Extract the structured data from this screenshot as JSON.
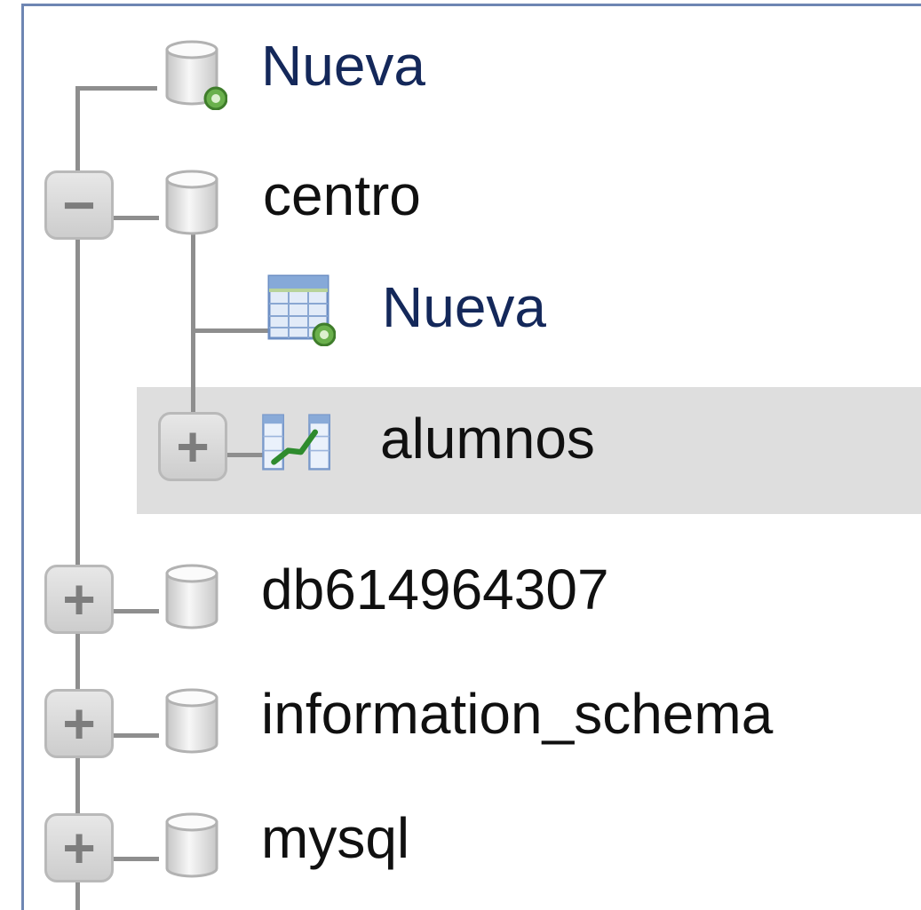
{
  "navigation_tree": {
    "new_database": {
      "label": "Nueva",
      "icon": "new-database-icon"
    },
    "databases": [
      {
        "name": "centro",
        "expanded": true,
        "expander_symbol": "−",
        "icon": "database-icon",
        "children": {
          "new_table": {
            "label": "Nueva",
            "icon": "new-table-icon"
          },
          "tables": [
            {
              "name": "alumnos",
              "expander_symbol": "+",
              "icon": "table-structure-icon",
              "highlighted": true
            }
          ]
        }
      },
      {
        "name": "db614964307",
        "expanded": false,
        "expander_symbol": "+",
        "icon": "database-icon"
      },
      {
        "name": "information_schema",
        "expanded": false,
        "expander_symbol": "+",
        "icon": "database-icon"
      },
      {
        "name": "mysql",
        "expanded": false,
        "expander_symbol": "+",
        "icon": "database-icon"
      }
    ]
  },
  "colors": {
    "frame_border": "#6e86b3",
    "tree_line": "#8e8e8e",
    "highlight_row": "#dedede",
    "new_badge": "#6ab04c",
    "new_item_text": "#14285a",
    "item_text": "#101010"
  }
}
